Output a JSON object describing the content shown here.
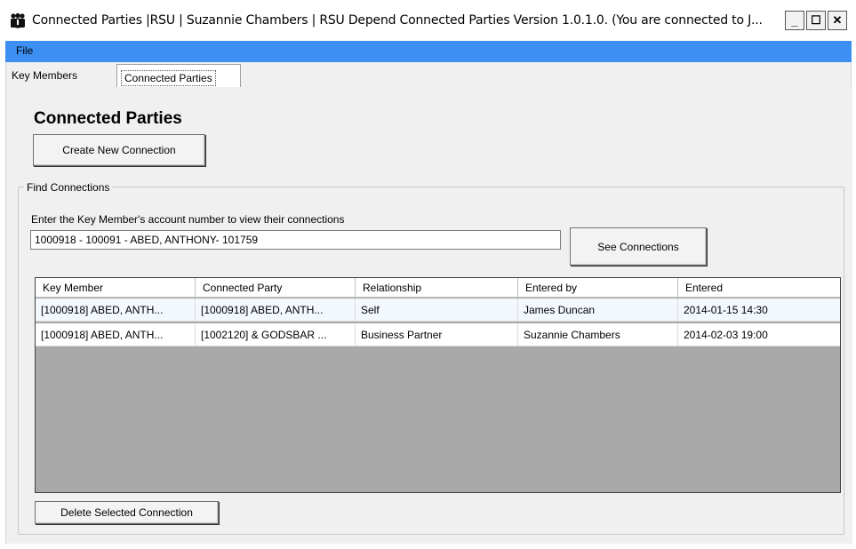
{
  "window": {
    "title": "Connected Parties |RSU | Suzannie Chambers | RSU Depend Connected Parties Version 1.0.1.0. (You are connected to J...",
    "icon": "people-icon",
    "minimize_label": "_",
    "maximize_label": "☐",
    "close_label": "✕"
  },
  "menu": {
    "file_label": "File",
    "bar_color": "#3d8ff3"
  },
  "tabs": [
    {
      "label": "Key Members"
    },
    {
      "label": "Connected Parties"
    }
  ],
  "page": {
    "heading": "Connected Parties",
    "create_button_label": "Create New Connection",
    "find_group_label": "Find Connections",
    "prompt": "Enter the Key Member's account number to view their connections",
    "account_value": "1000918 - 100091 - ABED, ANTHONY- 101759",
    "see_button_label": "See Connections",
    "delete_button_label": "Delete Selected Connection"
  },
  "grid": {
    "columns": [
      "Key Member",
      "Connected Party",
      "Relationship",
      "Entered by",
      "Entered"
    ],
    "rows": [
      [
        "[1000918] ABED, ANTH...",
        "[1000918] ABED, ANTH...",
        "Self",
        "James Duncan",
        "2014-01-15 14:30"
      ],
      [
        "[1000918] ABED, ANTH...",
        "[1002120] & GODSBAR ...",
        "Business Partner",
        "Suzannie Chambers",
        "2014-02-03 19:00"
      ]
    ]
  }
}
